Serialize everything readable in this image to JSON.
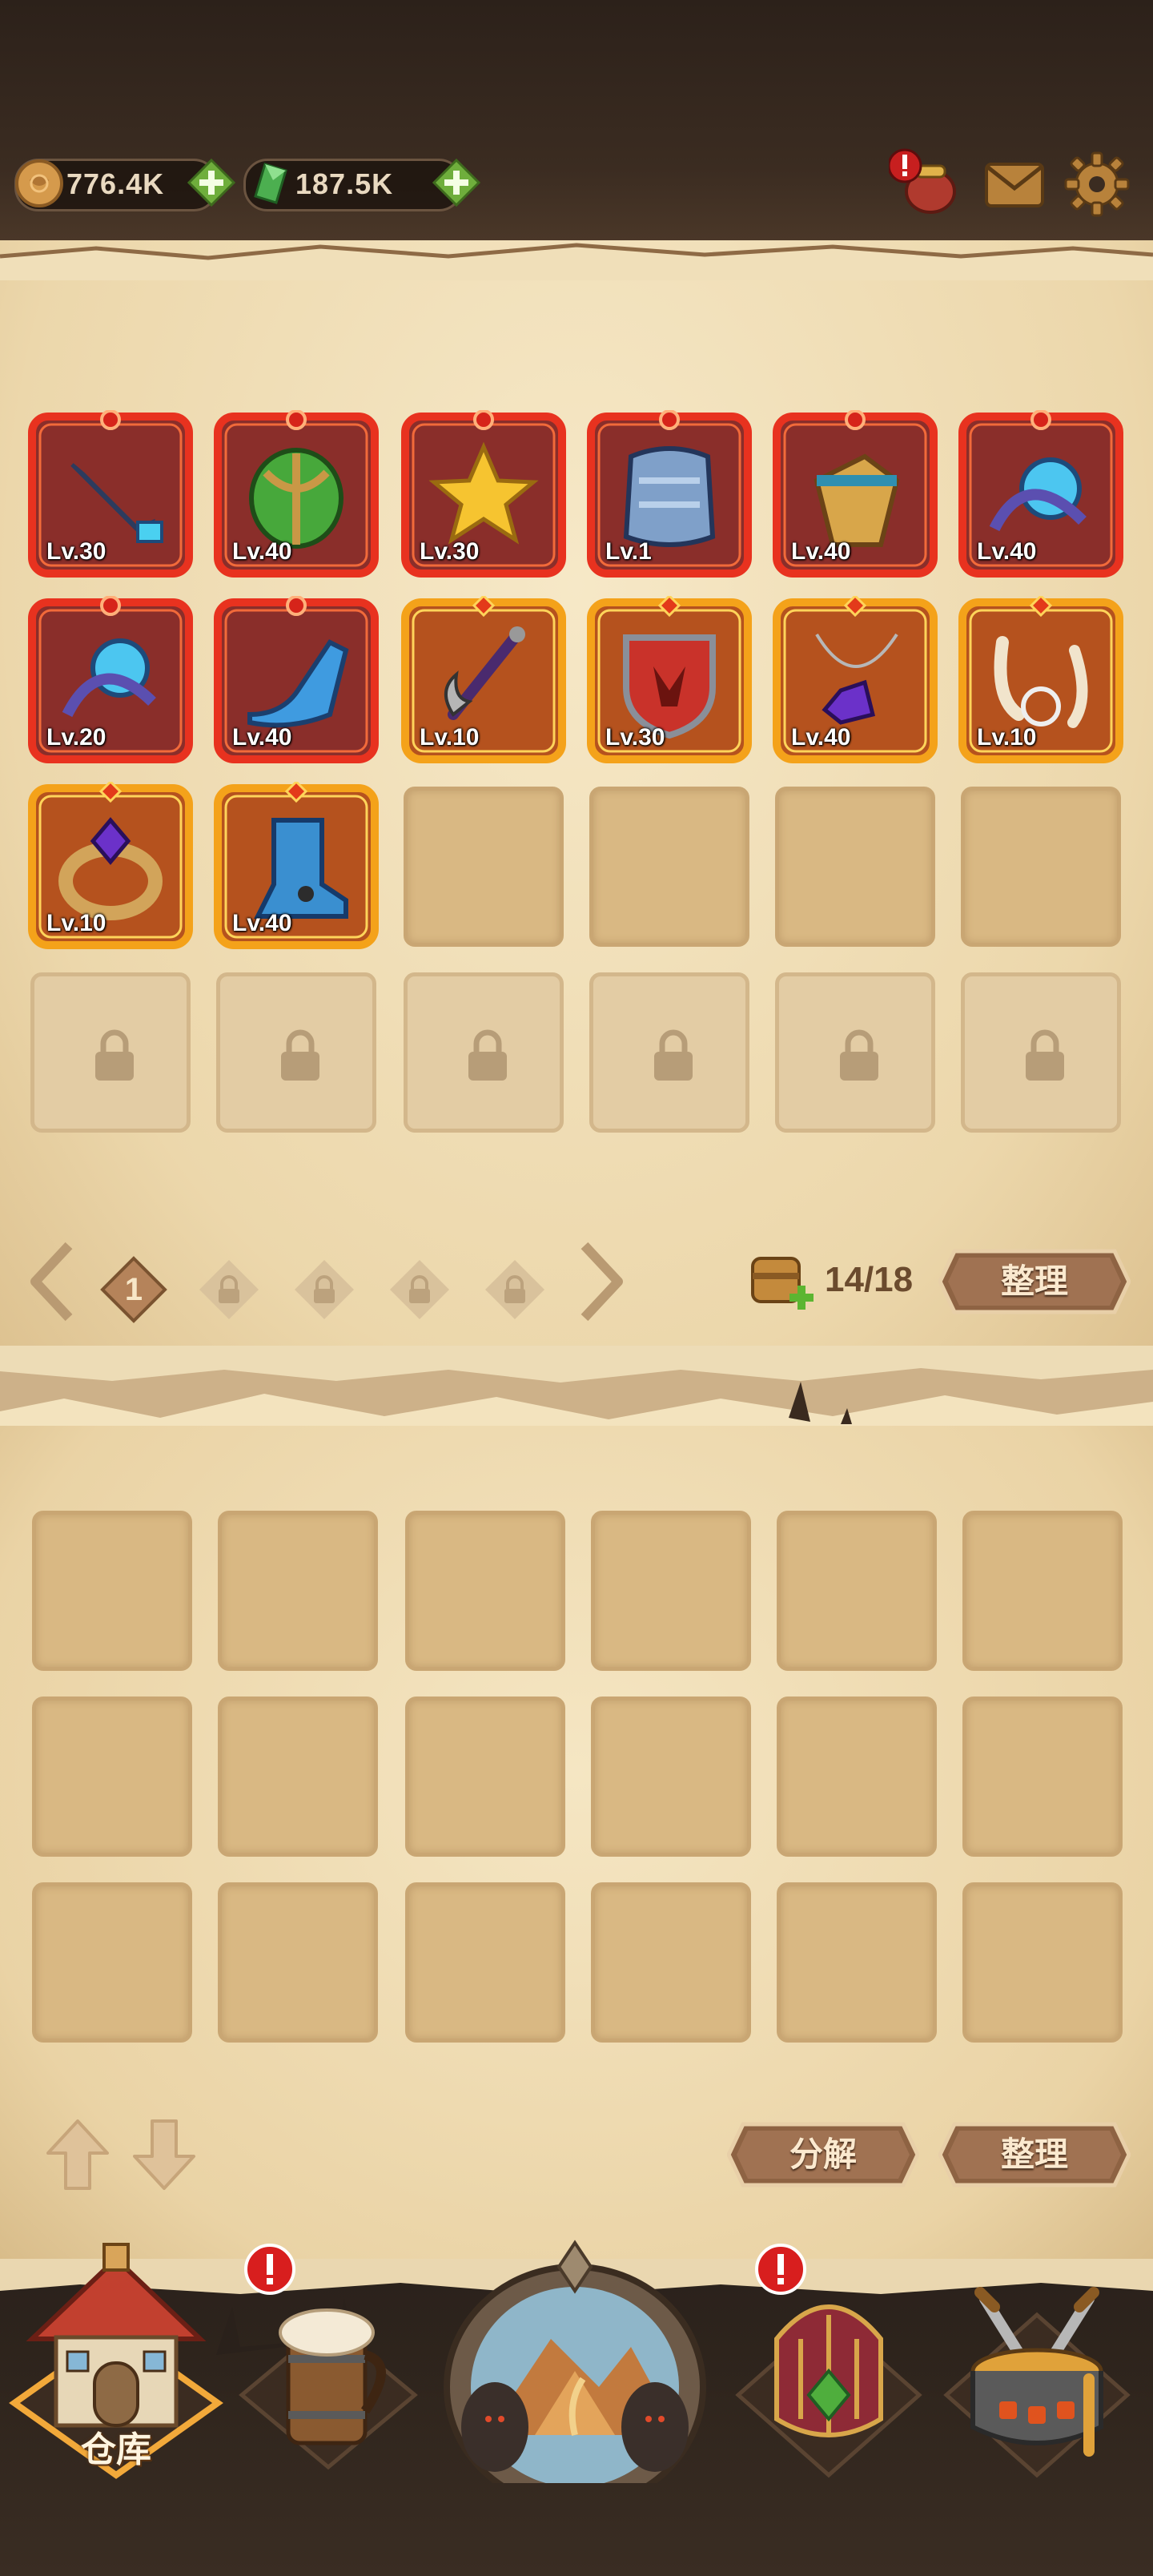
{
  "currency": {
    "coins": "776.4K",
    "gems": "187.5K"
  },
  "equipped_items": [
    {
      "name": "sword-blade",
      "level": "Lv.30",
      "rarity": "red"
    },
    {
      "name": "green-egg-helmet",
      "level": "Lv.40",
      "rarity": "red"
    },
    {
      "name": "star-charm",
      "level": "Lv.30",
      "rarity": "red"
    },
    {
      "name": "plate-armor",
      "level": "Lv.1",
      "rarity": "red"
    },
    {
      "name": "gold-gauntlet",
      "level": "Lv.40",
      "rarity": "red"
    },
    {
      "name": "orb-amulet",
      "level": "Lv.40",
      "rarity": "red"
    },
    {
      "name": "orb-amulet-2",
      "level": "Lv.20",
      "rarity": "red"
    },
    {
      "name": "glass-shoe",
      "level": "Lv.40",
      "rarity": "red"
    },
    {
      "name": "scythe-staff",
      "level": "Lv.10",
      "rarity": "orange"
    },
    {
      "name": "wolf-shield",
      "level": "Lv.30",
      "rarity": "orange"
    },
    {
      "name": "purple-gem-necklace",
      "level": "Lv.40",
      "rarity": "orange"
    },
    {
      "name": "fang-necklace",
      "level": "Lv.10",
      "rarity": "orange"
    },
    {
      "name": "amethyst-ring",
      "level": "Lv.10",
      "rarity": "orange"
    },
    {
      "name": "blue-boot",
      "level": "Lv.40",
      "rarity": "orange"
    }
  ],
  "pager": {
    "current_page": "1"
  },
  "capacity": "14/18",
  "buttons": {
    "sort_upper": "整理",
    "decompose": "分解",
    "sort_lower": "整理"
  },
  "nav": {
    "warehouse": "仓库"
  },
  "colors": {
    "red_frame": "#c8281e",
    "orange_frame": "#e68a12",
    "panel": "#efdcb3",
    "slot_empty": "#d9b883"
  }
}
